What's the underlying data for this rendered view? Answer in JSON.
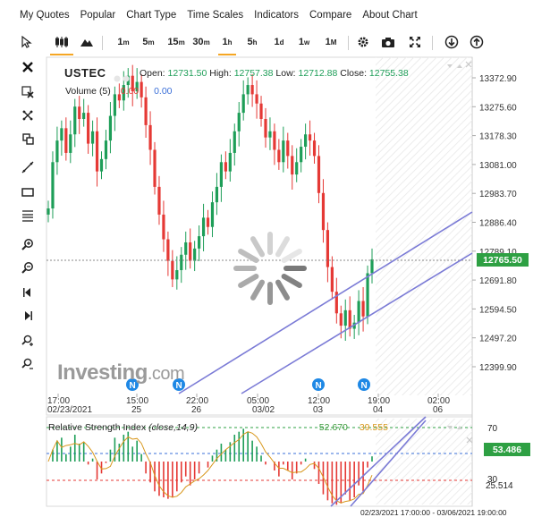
{
  "menu": [
    {
      "id": "my-quotes",
      "label": "My Quotes"
    },
    {
      "id": "popular",
      "label": "Popular"
    },
    {
      "id": "chart-type",
      "label": "Chart Type"
    },
    {
      "id": "time-scales",
      "label": "Time Scales"
    },
    {
      "id": "indicators",
      "label": "Indicators"
    },
    {
      "id": "compare",
      "label": "Compare"
    },
    {
      "id": "about-chart",
      "label": "About Chart"
    }
  ],
  "toolbar": {
    "timeframes": [
      {
        "num": "1",
        "unit": "m"
      },
      {
        "num": "5",
        "unit": "m"
      },
      {
        "num": "15",
        "unit": "m"
      },
      {
        "num": "30",
        "unit": "m"
      },
      {
        "num": "1",
        "unit": "h",
        "selected": true
      },
      {
        "num": "5",
        "unit": "h"
      },
      {
        "num": "1",
        "unit": "d"
      },
      {
        "num": "1",
        "unit": "w"
      },
      {
        "num": "1",
        "unit": "M"
      }
    ],
    "icons": [
      "cursor-icon",
      "candlestick-icon",
      "mountain-icon",
      "gear-icon",
      "camera-icon",
      "fullscreen-icon",
      "download-icon",
      "upload-icon"
    ]
  },
  "left_tools": [
    "close-icon",
    "delete-drawings-icon",
    "trash-icon",
    "clone-icon",
    "trendline-icon",
    "rectangle-icon",
    "fibonacci-icon",
    "zoom-in-icon",
    "zoom-out-icon",
    "scroll-left-icon",
    "scroll-right-icon",
    "zoom-fit-icon",
    "zoom-reset-icon"
  ],
  "symbol": "USTEC",
  "ohlc": {
    "open_label": "Open:",
    "open": "12731.50",
    "high_label": "High:",
    "high": "12757.38",
    "low_label": "Low:",
    "low": "12712.88",
    "close_label": "Close:",
    "close": "12755.38"
  },
  "volume": {
    "label": "Volume (5)",
    "val1": "0.00",
    "val2": "0.00"
  },
  "price_axis": [
    "13372.90",
    "13275.60",
    "13178.30",
    "13081.00",
    "12983.70",
    "12886.40",
    "12789.10",
    "12691.80",
    "12594.50",
    "12497.20",
    "12399.90"
  ],
  "current_price": "12765.50",
  "time_axis": [
    {
      "top": "17:00",
      "bottom": "02/23/2021"
    },
    {
      "top": "15:00",
      "bottom": "25"
    },
    {
      "top": "22:00",
      "bottom": "26"
    },
    {
      "top": "05:00",
      "bottom": "03/02"
    },
    {
      "top": "12:00",
      "bottom": "03"
    },
    {
      "top": "19:00",
      "bottom": "04"
    },
    {
      "top": "02:00",
      "bottom": "06"
    }
  ],
  "news_marker": "N",
  "rsi": {
    "title": "Relative Strength Index",
    "params": "(close,14,9)",
    "value": "52.670",
    "signal": "39.555",
    "levels": [
      "70",
      "30"
    ],
    "current": "53.486",
    "low_label": "25.514"
  },
  "logo": {
    "main": "Investing",
    "suffix": ".com"
  },
  "footer": "02/23/2021 17:00:00 - 03/06/2021 19:00:00",
  "colors": {
    "up": "#1e9e58",
    "down": "#e53935",
    "channel": "#7b7bd6",
    "accent": "#f5a623",
    "price_tag": "#2ea043",
    "news": "#1e88e5"
  },
  "chart_data": {
    "type": "candlestick",
    "ylim": [
      12330,
      13420
    ],
    "close": [
      12930,
      13080,
      13150,
      13190,
      13110,
      13170,
      13260,
      13220,
      13240,
      13140,
      13180,
      13050,
      13090,
      13150,
      13230,
      13300,
      13280,
      13330,
      13360,
      13310,
      13340,
      13290,
      13200,
      13120,
      13000,
      12910,
      12830,
      12760,
      12700,
      12730,
      12780,
      12820,
      12760,
      12800,
      12840,
      12900,
      12870,
      12950,
      13000,
      13080,
      13050,
      13110,
      13180,
      13240,
      13300,
      13330,
      13300,
      13270,
      13220,
      13160,
      13180,
      13120,
      13080,
      13150,
      13100,
      13040,
      13080,
      13130,
      13170,
      13150,
      13100,
      12980,
      12860,
      12740,
      12660,
      12590,
      12550,
      12600,
      12540,
      12560,
      12630,
      12580,
      12720,
      12765
    ],
    "rsi_ylim": [
      20,
      80
    ],
    "rsi_values": [
      50,
      58,
      64,
      66,
      55,
      60,
      68,
      62,
      63,
      48,
      52,
      38,
      42,
      49,
      58,
      66,
      62,
      68,
      70,
      60,
      64,
      55,
      42,
      36,
      30,
      27,
      26,
      25,
      26,
      30,
      36,
      40,
      34,
      38,
      42,
      50,
      46,
      54,
      58,
      62,
      58,
      63,
      68,
      70,
      72,
      70,
      64,
      60,
      54,
      48,
      50,
      44,
      40,
      48,
      44,
      38,
      42,
      48,
      52,
      50,
      45,
      35,
      28,
      24,
      22,
      21,
      22,
      28,
      24,
      26,
      34,
      30,
      46,
      53.486
    ]
  }
}
